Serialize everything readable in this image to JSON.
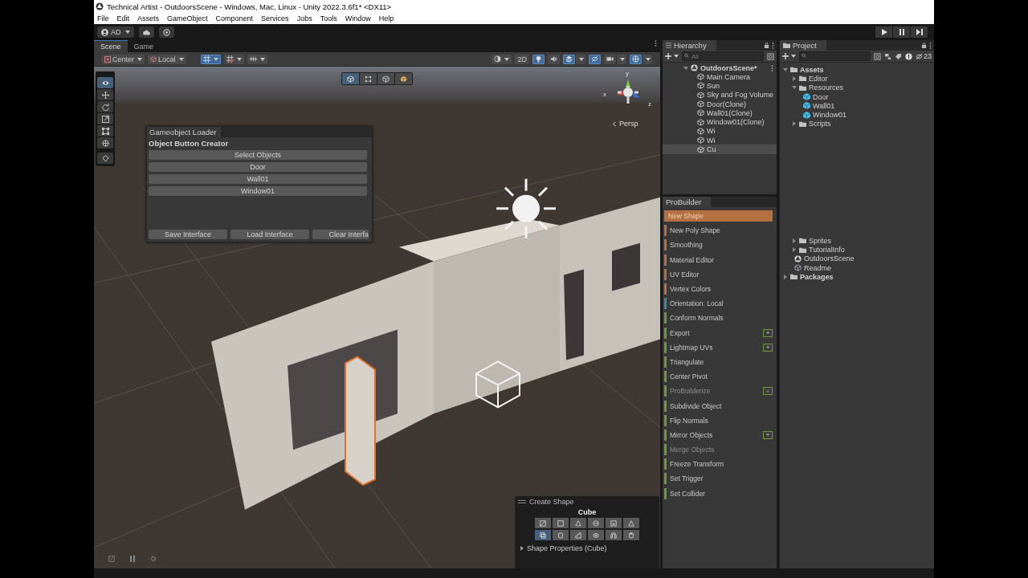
{
  "window": {
    "title": "Technical Artist - OutdoorsScene - Windows, Mac, Linux - Unity 2022.3.6f1* <DX11>"
  },
  "menu": [
    "File",
    "Edit",
    "Assets",
    "GameObject",
    "Component",
    "Services",
    "Jobs",
    "Tools",
    "Window",
    "Help"
  ],
  "toolbar": {
    "account": "AD"
  },
  "scene_view": {
    "tabs": [
      {
        "label": "Scene",
        "selected": true
      },
      {
        "label": "Game",
        "selected": false
      }
    ],
    "pivot": "Center",
    "space": "Local",
    "mode_2d": "2D",
    "toggles": [
      {
        "kind": "light",
        "on": true
      },
      {
        "kind": "audio",
        "on": false
      },
      {
        "kind": "effects",
        "on": true
      },
      {
        "kind": "hidden",
        "on": true
      },
      {
        "kind": "camera",
        "on": false
      },
      {
        "kind": "gizmos",
        "on": true
      }
    ],
    "tools": [
      {
        "kind": "view",
        "selected": true
      },
      {
        "kind": "move",
        "selected": false
      },
      {
        "kind": "rotate",
        "selected": false
      },
      {
        "kind": "scale",
        "selected": false
      },
      {
        "kind": "rect",
        "selected": false
      },
      {
        "kind": "transform",
        "selected": false
      },
      {
        "kind": "custom",
        "selected": false
      }
    ],
    "selection_modes": [
      {
        "kind": "object",
        "selected": true
      },
      {
        "kind": "vertex",
        "selected": false
      },
      {
        "kind": "edge",
        "selected": false
      },
      {
        "kind": "face",
        "selected": false
      }
    ],
    "gizmo_labels": [
      "y",
      "x",
      "z"
    ],
    "projection": "Persp",
    "create_shape": {
      "title": "Create Shape",
      "shape": "Cube",
      "properties": "Shape Properties (Cube)",
      "shapes": [
        {
          "kind": "plane",
          "selected": false
        },
        {
          "kind": "quad",
          "selected": false
        },
        {
          "kind": "cone",
          "selected": false
        },
        {
          "kind": "sphere",
          "selected": false
        },
        {
          "kind": "door",
          "selected": false
        },
        {
          "kind": "prism",
          "selected": false
        },
        {
          "kind": "cube",
          "selected": true
        },
        {
          "kind": "cylinder",
          "selected": false
        },
        {
          "kind": "stairs",
          "selected": false
        },
        {
          "kind": "torus",
          "selected": false
        },
        {
          "kind": "arch",
          "selected": false
        },
        {
          "kind": "pipe",
          "selected": false
        }
      ]
    }
  },
  "hierarchy": {
    "title": "Hierarchy",
    "search": {
      "placeholder": "All"
    },
    "scene": "OutdoorsScene*",
    "items": [
      {
        "label": "Main Camera",
        "selected": false
      },
      {
        "label": "Sun",
        "selected": false
      },
      {
        "label": "Sky and Fog Volume",
        "selected": false
      },
      {
        "label": "Door(Clone)",
        "selected": false
      },
      {
        "label": "Wall01(Clone)",
        "selected": false
      },
      {
        "label": "Window01(Clone)",
        "selected": false
      },
      {
        "label": "Wi",
        "selected": false
      },
      {
        "label": "Wi",
        "selected": false
      },
      {
        "label": "Cu",
        "selected": true
      }
    ]
  },
  "project": {
    "title": "Project",
    "hidden_count": "23",
    "tree": [
      {
        "label": "Assets",
        "kind": "folder",
        "expanded": true,
        "children": [
          {
            "label": "Editor",
            "kind": "folder",
            "expanded": false
          },
          {
            "label": "Resources",
            "kind": "folder",
            "expanded": true,
            "children": [
              {
                "label": "Door",
                "kind": "prefab"
              },
              {
                "label": "Wall01",
                "kind": "prefab"
              },
              {
                "label": "Window01",
                "kind": "prefab"
              }
            ]
          },
          {
            "label": "Scripts",
            "kind": "folder",
            "expanded": false
          },
          {
            "label": "Sprites",
            "kind": "folder",
            "expanded": false
          },
          {
            "label": "TutorialInfo",
            "kind": "folder",
            "expanded": false
          },
          {
            "label": "OutdoorsScene",
            "kind": "scene"
          },
          {
            "label": "Readme",
            "kind": "asset"
          }
        ]
      },
      {
        "label": "Packages",
        "kind": "folder",
        "expanded": false
      }
    ]
  },
  "probuilder": {
    "title": "ProBuilder",
    "items": [
      {
        "label": "New Shape",
        "color": "#b5703f",
        "selected": true,
        "disabled": false
      },
      {
        "label": "New Poly Shape",
        "color": "#b5703f",
        "selected": false,
        "disabled": false
      },
      {
        "label": "Smoothing",
        "color": "#b5703f",
        "selected": false,
        "disabled": false
      },
      {
        "label": "Material Editor",
        "color": "#b5703f",
        "selected": false,
        "disabled": false
      },
      {
        "label": "UV Editor",
        "color": "#b5703f",
        "selected": false,
        "disabled": false
      },
      {
        "label": "Vertex Colors",
        "color": "#b5703f",
        "selected": false,
        "disabled": false
      },
      {
        "label": "Orientation: Local",
        "color": "#3d8aa0",
        "selected": false,
        "disabled": false
      },
      {
        "label": "Conform Normals",
        "color": "#6c9a34",
        "selected": false,
        "disabled": false
      },
      {
        "label": "Export",
        "color": "#6c9a34",
        "selected": false,
        "disabled": false,
        "options": "+"
      },
      {
        "label": "Lightmap UVs",
        "color": "#6c9a34",
        "selected": false,
        "disabled": false,
        "options": "+"
      },
      {
        "label": "Triangulate",
        "color": "#6c9a34",
        "selected": false,
        "disabled": false
      },
      {
        "label": "Center Pivot",
        "color": "#6c9a34",
        "selected": false,
        "disabled": false
      },
      {
        "label": "ProBuilderize",
        "color": "#6c9a34",
        "selected": false,
        "disabled": true,
        "options": "+"
      },
      {
        "label": "Subdivide Object",
        "color": "#6c9a34",
        "selected": false,
        "disabled": false
      },
      {
        "label": "Flip Normals",
        "color": "#6c9a34",
        "selected": false,
        "disabled": false
      },
      {
        "label": "Mirror Objects",
        "color": "#6c9a34",
        "selected": false,
        "disabled": false,
        "options": "+"
      },
      {
        "label": "Merge Objects",
        "color": "#6c9a34",
        "selected": false,
        "disabled": true
      },
      {
        "label": "Freeze Transform",
        "color": "#6c9a34",
        "selected": false,
        "disabled": false
      },
      {
        "label": "Set Trigger",
        "color": "#6c9a34",
        "selected": false,
        "disabled": false
      },
      {
        "label": "Set Collider",
        "color": "#6c9a34",
        "selected": false,
        "disabled": false
      }
    ]
  },
  "loader": {
    "title": "Gameobject Loader",
    "heading": "Object Button Creator",
    "buttons": [
      "Select Objects",
      "Door",
      "Wall01",
      "Window01"
    ],
    "footer": [
      "Save Interface",
      "Load Interface",
      "Clear Interfa"
    ]
  }
}
